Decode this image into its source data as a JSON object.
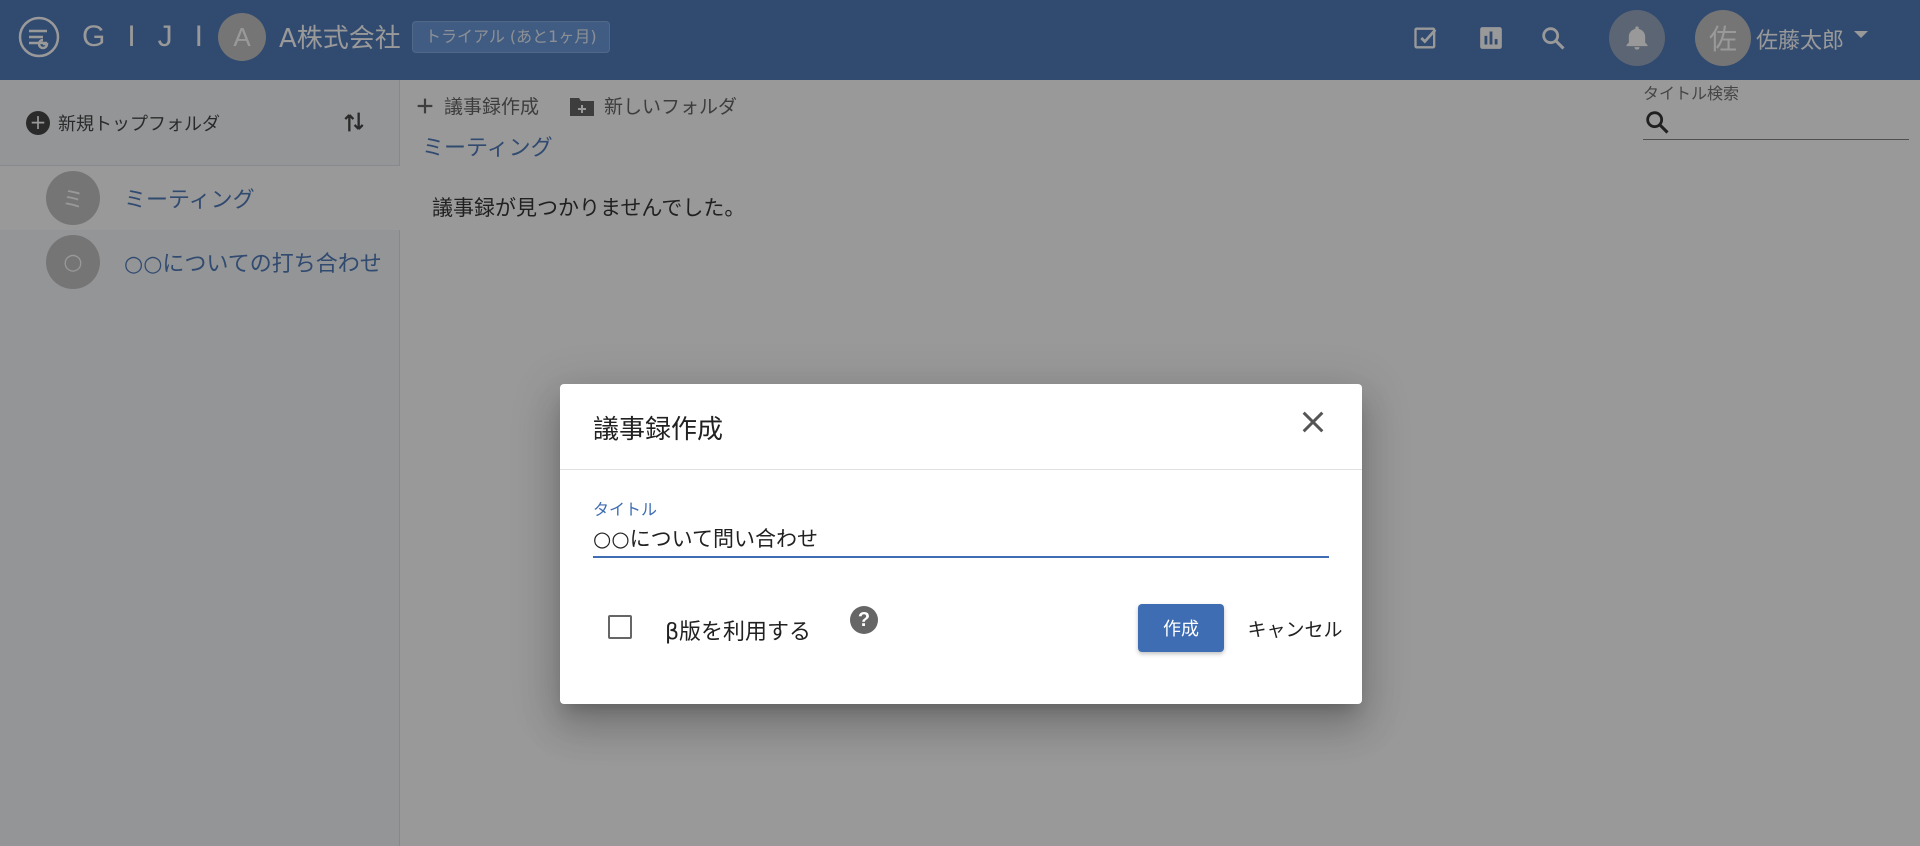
{
  "header": {
    "logo_text": "GIJI",
    "company_initial": "A",
    "company_name": "A株式会社",
    "trial_badge": "トライアル (あと1ヶ月)",
    "icons": [
      "task-check-icon",
      "chart-icon",
      "search-icon",
      "bell-icon"
    ],
    "user_initial": "佐",
    "user_name": "佐藤太郎"
  },
  "sidebar": {
    "new_top_folder": "新規トップフォルダ",
    "items": [
      {
        "initial": "ミ",
        "label": "ミーティング",
        "active": true
      },
      {
        "initial": "○",
        "label": "○○についての打ち合わせ",
        "active": false
      }
    ]
  },
  "main": {
    "toolbar": {
      "create_minutes": "議事録作成",
      "new_folder": "新しいフォルダ"
    },
    "breadcrumb": "ミーティング",
    "empty_message": "議事録が見つかりませんでした。",
    "search": {
      "label": "タイトル検索",
      "value": ""
    }
  },
  "dialog": {
    "title": "議事録作成",
    "field_label": "タイトル",
    "title_value": "○○について問い合わせ",
    "beta_label": "β版を利用する",
    "beta_checked": false,
    "create_label": "作成",
    "cancel_label": "キャンセル"
  },
  "colors": {
    "primary": "#3f6db3",
    "overlay": "rgba(33,33,33,0.46)",
    "badge": "#5b8fd6"
  }
}
